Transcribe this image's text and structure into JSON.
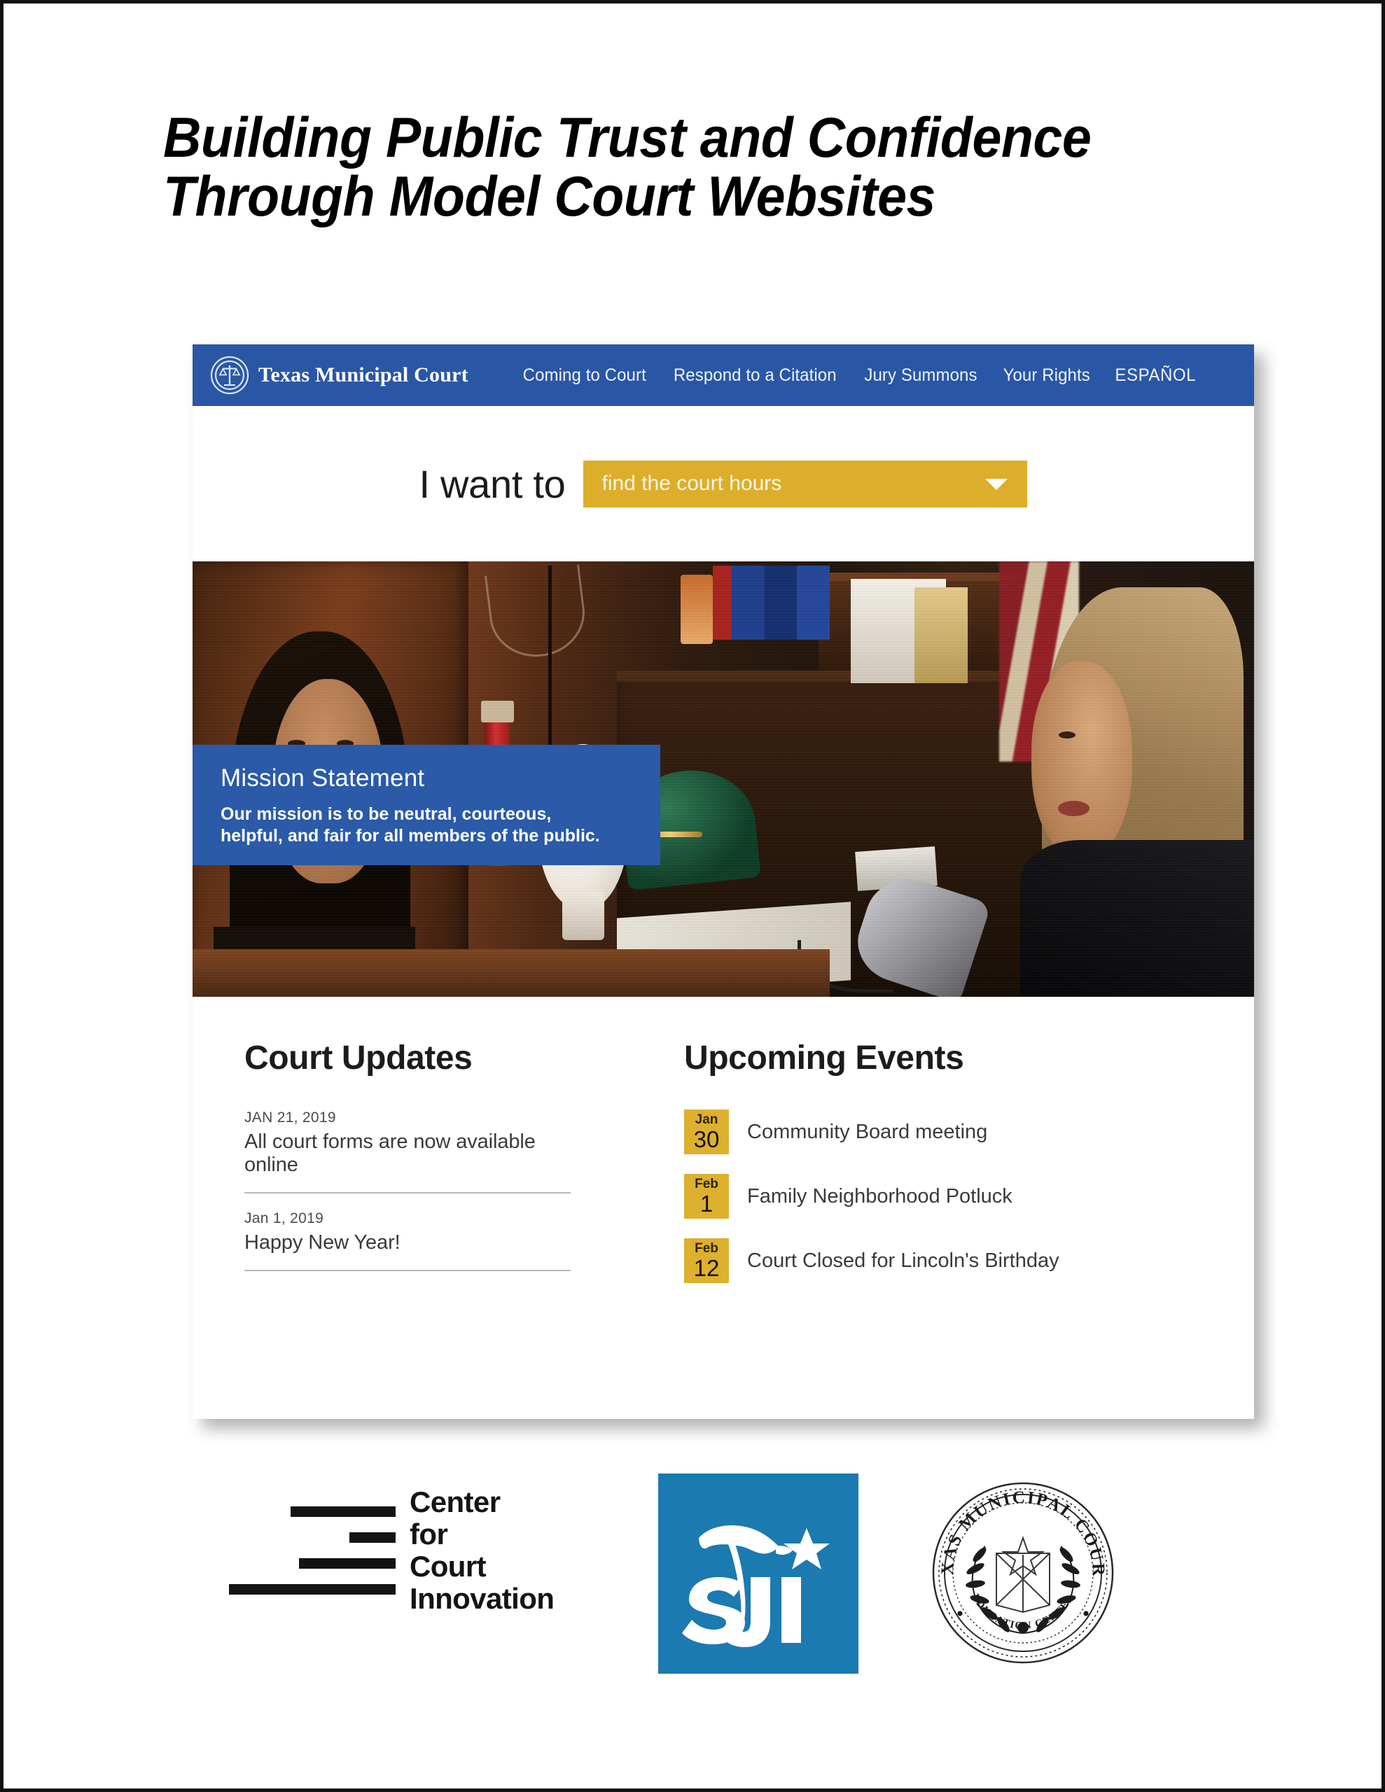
{
  "poster": {
    "title_line_1": "Building Public Trust and Confidence",
    "title_line_2": "Through Model Court Websites"
  },
  "colors": {
    "nav_blue": "#2a57a5",
    "mission_blue": "#2a5aa8",
    "gold": "#ddb02e",
    "sji_blue": "#1b7ab0",
    "text_dark": "#1c1c1c"
  },
  "site": {
    "navbar": {
      "logo_icon": "scales-of-justice-icon",
      "brand": "Texas Municipal Court",
      "items": [
        {
          "label": "Coming to Court"
        },
        {
          "label": "Respond to a Citation"
        },
        {
          "label": "Jury Summons"
        },
        {
          "label": "Your Rights"
        },
        {
          "label": "ESPAÑOL"
        }
      ]
    },
    "i_want_to": {
      "label": "I want to",
      "selected_option": "find the court hours",
      "chevron_icon": "chevron-down-icon"
    },
    "hero": {
      "mission_title": "Mission Statement",
      "mission_text": "Our mission is to be neutral, courteous, helpful, and fair for all members of the public."
    },
    "updates": {
      "heading": "Court Updates",
      "items": [
        {
          "date": "JAN 21, 2019",
          "text": "All court forms are now available online"
        },
        {
          "date": "Jan 1, 2019",
          "text": "Happy New Year!"
        }
      ]
    },
    "events": {
      "heading": "Upcoming Events",
      "items": [
        {
          "month": "Jan",
          "day": "30",
          "label": "Community Board meeting"
        },
        {
          "month": "Feb",
          "day": "1",
          "label": "Family Neighborhood Potluck"
        },
        {
          "month": "Feb",
          "day": "12",
          "label": "Court Closed for Lincoln's Birthday"
        }
      ]
    }
  },
  "footer": {
    "cci": {
      "icon": "center-for-court-innovation-bars-icon",
      "line_1": "Center",
      "line_2": "for",
      "line_3": "Court",
      "line_4": "Innovation"
    },
    "sji": {
      "icon": "sji-eagle-star-logo-icon",
      "wordmark": "sJi"
    },
    "tmcec": {
      "icon": "texas-municipal-courts-education-center-seal-icon",
      "outer_text": "TEXAS MUNICIPAL COURTS",
      "bottom_text": "EDUCATION CENTER"
    }
  }
}
